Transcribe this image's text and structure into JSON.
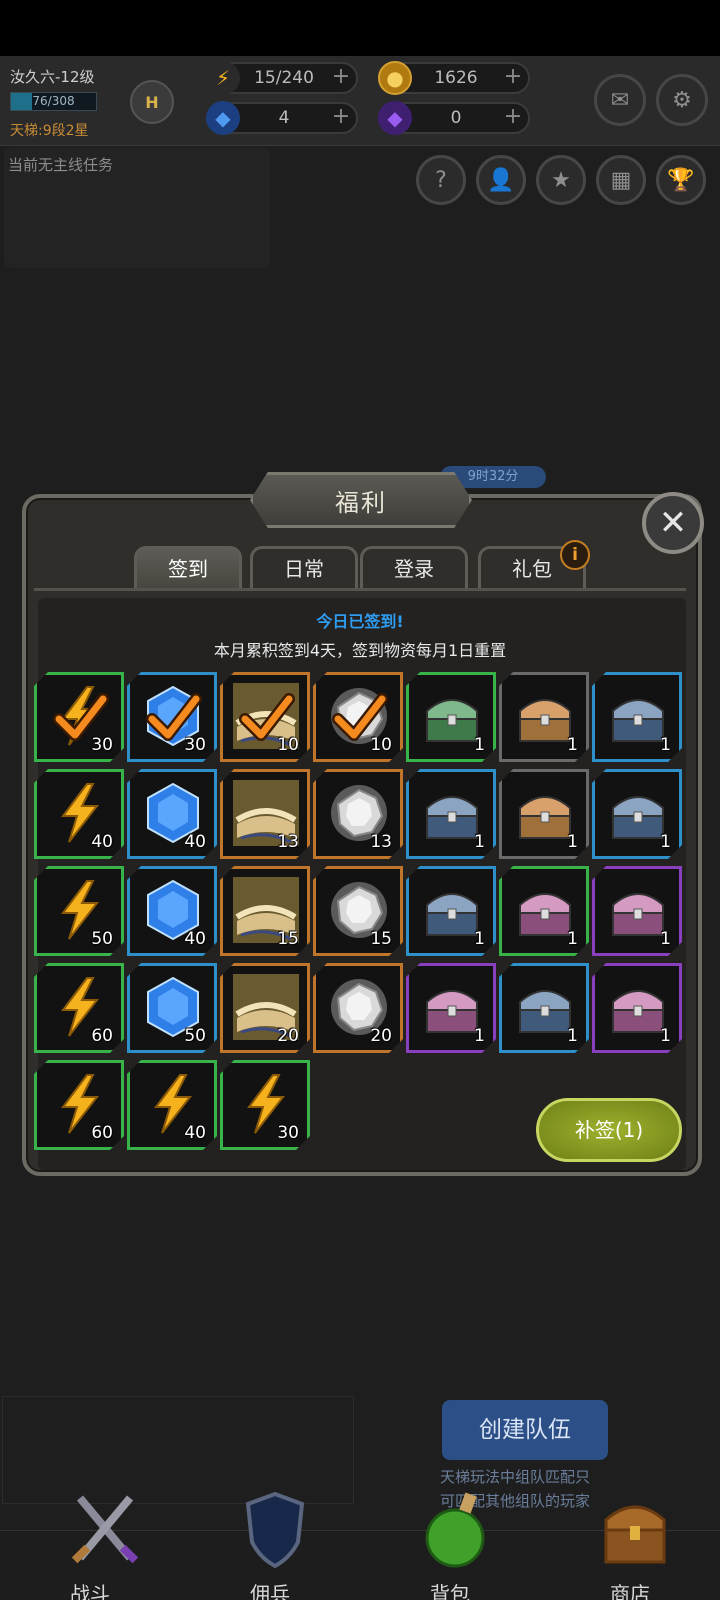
{
  "player": {
    "name": "汝久六-12级",
    "xp": "76/308",
    "xp_fraction": 0.247,
    "ladder": "天梯:9段2星",
    "emblem_letter": "H"
  },
  "resources": [
    {
      "icon": "lightning-icon",
      "value": "15/240"
    },
    {
      "icon": "gold-coin-icon",
      "value": "1626"
    },
    {
      "icon": "blue-gem-icon",
      "value": "4"
    },
    {
      "icon": "purple-gem-icon",
      "value": "0"
    }
  ],
  "resource_plus": "+",
  "quest_text": "当前无主线任务",
  "timer_text": "9时32分",
  "dialog": {
    "title": "福利",
    "close_symbol": "✕",
    "tabs": [
      {
        "label": "签到",
        "active": true
      },
      {
        "label": "日常",
        "active": false
      },
      {
        "label": "登录",
        "active": false
      },
      {
        "label": "礼包",
        "active": false
      }
    ],
    "info_badge": "i",
    "signed_message": "今日已签到!",
    "accumulated_message": "本月累积签到4天，签到物资每月1日重置",
    "resign_button": "补签(1)"
  },
  "rewards": [
    {
      "type": "energy",
      "qty": "30",
      "frame": "green",
      "checked": true
    },
    {
      "type": "gem",
      "qty": "30",
      "frame": "blue",
      "checked": true
    },
    {
      "type": "book",
      "qty": "10",
      "frame": "orange",
      "checked": true
    },
    {
      "type": "ore",
      "qty": "10",
      "frame": "orange",
      "checked": true
    },
    {
      "type": "chest-green",
      "qty": "1",
      "frame": "green",
      "checked": false
    },
    {
      "type": "chest-gold",
      "qty": "1",
      "frame": "gray",
      "checked": false
    },
    {
      "type": "chest-blue",
      "qty": "1",
      "frame": "blue",
      "checked": false
    },
    {
      "type": "energy",
      "qty": "40",
      "frame": "green",
      "checked": false
    },
    {
      "type": "gem",
      "qty": "40",
      "frame": "blue",
      "checked": false
    },
    {
      "type": "book",
      "qty": "13",
      "frame": "orange",
      "checked": false
    },
    {
      "type": "ore",
      "qty": "13",
      "frame": "orange",
      "checked": false
    },
    {
      "type": "chest-blue",
      "qty": "1",
      "frame": "blue",
      "checked": false
    },
    {
      "type": "chest-gold",
      "qty": "1",
      "frame": "gray",
      "checked": false
    },
    {
      "type": "chest-blue",
      "qty": "1",
      "frame": "blue",
      "checked": false
    },
    {
      "type": "energy",
      "qty": "50",
      "frame": "green",
      "checked": false
    },
    {
      "type": "gem",
      "qty": "40",
      "frame": "blue",
      "checked": false
    },
    {
      "type": "book",
      "qty": "15",
      "frame": "orange",
      "checked": false
    },
    {
      "type": "ore",
      "qty": "15",
      "frame": "orange",
      "checked": false
    },
    {
      "type": "chest-blue",
      "qty": "1",
      "frame": "blue",
      "checked": false
    },
    {
      "type": "chest-pink",
      "qty": "1",
      "frame": "green",
      "checked": false
    },
    {
      "type": "chest-pink",
      "qty": "1",
      "frame": "purple",
      "checked": false
    },
    {
      "type": "energy",
      "qty": "60",
      "frame": "green",
      "checked": false
    },
    {
      "type": "gem",
      "qty": "50",
      "frame": "blue",
      "checked": false
    },
    {
      "type": "book",
      "qty": "20",
      "frame": "orange",
      "checked": false
    },
    {
      "type": "ore",
      "qty": "20",
      "frame": "orange",
      "checked": false
    },
    {
      "type": "chest-pink",
      "qty": "1",
      "frame": "purple",
      "checked": false
    },
    {
      "type": "chest-blue",
      "qty": "1",
      "frame": "blue",
      "checked": false
    },
    {
      "type": "chest-pink",
      "qty": "1",
      "frame": "purple",
      "checked": false
    },
    {
      "type": "energy",
      "qty": "60",
      "frame": "green",
      "checked": false
    },
    {
      "type": "energy",
      "qty": "40",
      "frame": "green",
      "checked": false
    },
    {
      "type": "energy",
      "qty": "30",
      "frame": "green",
      "checked": false
    }
  ],
  "team": {
    "button": "创建队伍",
    "hint_line1": "天梯玩法中组队匹配只",
    "hint_line2": "可匹配其他组队的玩家"
  },
  "nav": [
    {
      "label": "战斗",
      "icon": "swords-icon"
    },
    {
      "label": "佣兵",
      "icon": "shield-icon"
    },
    {
      "label": "背包",
      "icon": "potion-icon"
    },
    {
      "label": "商店",
      "icon": "treasure-chest-icon"
    }
  ],
  "colors": {
    "frame_green": "#37b34a",
    "frame_blue": "#2e8fc9",
    "frame_orange": "#c0762a",
    "frame_gray": "#6a6a6a",
    "frame_purple": "#8a3fbf",
    "signed_text": "#2e9cf0",
    "resign_button": "#9fb12c"
  }
}
